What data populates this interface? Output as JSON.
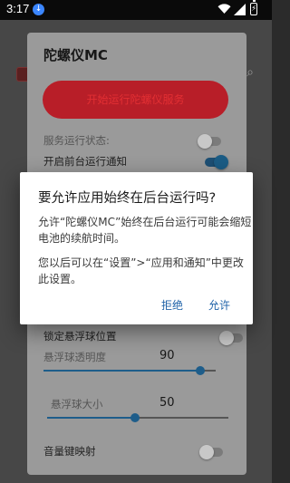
{
  "status_bar": {
    "time": "3:17",
    "notif_icon": "download-indicator-icon",
    "icons": [
      "wifi-icon",
      "signal-icon",
      "battery-charging-icon"
    ]
  },
  "card": {
    "title": "陀螺仪MC",
    "main_button": "开始运行陀螺仪服务",
    "rows": {
      "service_status": "服务运行状态:",
      "foreground_notify": "开启前台运行通知",
      "lock_ball": "锁定悬浮球位置",
      "ball_opacity": "悬浮球透明度",
      "ball_opacity_value": "90",
      "ball_size": "悬浮球大小",
      "ball_size_value": "50",
      "volume_map": "音量键映射"
    },
    "slider_levels": {
      "ball_opacity": 0.9,
      "ball_size": 0.5
    },
    "toggles": {
      "service_status": false,
      "foreground_notify": true,
      "lock_ball": false,
      "volume_map": false
    }
  },
  "dialog": {
    "title": "要允许应用始终在后台运行吗?",
    "message": "允许“陀螺仪MC”始终在后台运行可能会缩短电池的续航时间。",
    "hint": "您以后可以在“设置”>“应用和通知”中更改此设置。",
    "deny": "拒绝",
    "allow": "允许"
  },
  "colors": {
    "accent": "#1f62a8",
    "danger": "#b81e28"
  }
}
